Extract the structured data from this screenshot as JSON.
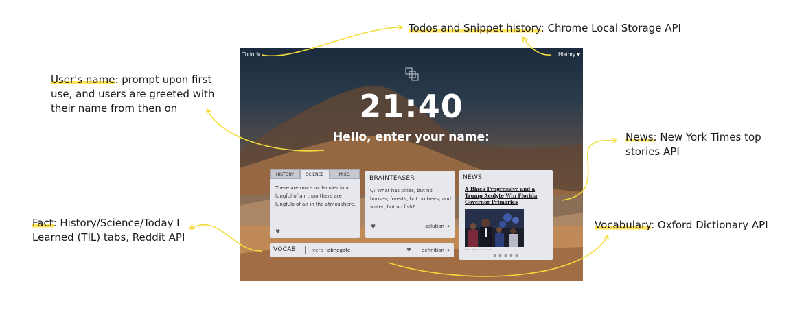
{
  "annotations": {
    "storage": {
      "term": "Todos and Snippet history",
      "desc": ": Chrome Local Storage API"
    },
    "name": {
      "term": "User's name",
      "desc": ": prompt upon first use, and users are greeted with their name from then on"
    },
    "news": {
      "term": "News",
      "desc": ": New York Times top stories API"
    },
    "fact": {
      "term": "Fact",
      "desc": ": History/Science/Today I Learned (TIL) tabs, Reddit API"
    },
    "vocab": {
      "term": "Vocabulary",
      "desc": ": Oxford Dictionary API"
    }
  },
  "app": {
    "todo_link": "Todo ✎",
    "history_link": "History ♥",
    "clock": "21:40",
    "greeting": "Hello, enter your name:",
    "fact": {
      "tabs": [
        "HISTORY",
        "SCIENCE",
        "MISC."
      ],
      "active_tab": "SCIENCE",
      "text": "There are more molecules in a lungful of air than there are lungfuls of air in the atmosphere."
    },
    "brainteaser": {
      "title": "BRAINTEASER",
      "text": "Q: What has cities, but no houses; forests, but no trees; and water, but no fish?",
      "solution_link": "solution →"
    },
    "news": {
      "title": "NEWS",
      "headline": "A Black Progressive and a Trump Acolyte Win Florida Governor Primaries",
      "caption": "Photo: Primaries in Florida",
      "dots": "● ● ● ● ●"
    },
    "vocab": {
      "label": "VOCAB",
      "part_of_speech": "verb",
      "word": "abnegate",
      "definition_link": "definition →"
    },
    "heart_glyph": "♥"
  },
  "colors": {
    "highlight": "#ffe45c",
    "arrow": "#f2dc3c",
    "card": "#e7e8ed"
  }
}
